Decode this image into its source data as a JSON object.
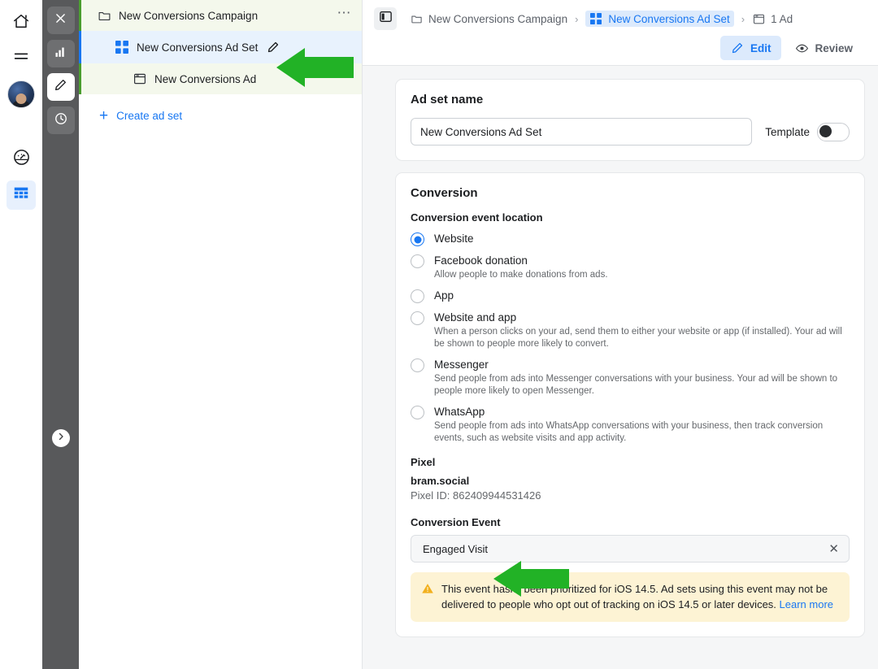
{
  "icon_rail": {
    "items": [
      {
        "name": "home-icon",
        "label": "Home"
      },
      {
        "name": "menu-icon",
        "label": "Menu"
      },
      {
        "name": "avatar",
        "label": "Account"
      },
      {
        "name": "speedometer-icon",
        "label": "Performance"
      },
      {
        "name": "grid-table-icon",
        "label": "Ads Manager"
      }
    ]
  },
  "dark_rail": {
    "items": [
      {
        "name": "close-icon",
        "label": "Close"
      },
      {
        "name": "bar-chart-icon",
        "label": "Reports"
      },
      {
        "name": "pencil-icon",
        "label": "Edit",
        "active": true
      },
      {
        "name": "clock-icon",
        "label": "History"
      }
    ],
    "expand_label": "Expand panel"
  },
  "tree": {
    "rows": [
      {
        "label": "New Conversions Campaign",
        "icon": "folder-icon",
        "kind": "campaign",
        "has_menu": true,
        "has_pencil": false
      },
      {
        "label": "New Conversions Ad Set",
        "icon": "grid-squares-icon",
        "kind": "adset",
        "has_menu": false,
        "has_pencil": true
      },
      {
        "label": "New Conversions Ad",
        "icon": "ad-window-icon",
        "kind": "ad",
        "has_menu": true,
        "has_pencil": false
      }
    ],
    "create_label": "Create ad set",
    "create_plus": "+"
  },
  "topbar": {
    "panel_toggle_name": "panel-toggle-icon",
    "breadcrumb": [
      {
        "label": "New Conversions Campaign",
        "icon": "folder-icon",
        "current": false
      },
      {
        "label": "New Conversions Ad Set",
        "icon": "grid-squares-icon",
        "current": true
      },
      {
        "label": "1 Ad",
        "icon": "ad-window-icon",
        "current": false
      }
    ],
    "separator": "›",
    "actions": [
      {
        "label": "Edit",
        "icon": "pencil-icon",
        "active": true
      },
      {
        "label": "Review",
        "icon": "eye-icon",
        "active": false
      }
    ]
  },
  "ad_set_name": {
    "title": "Ad set name",
    "value": "New Conversions Ad Set",
    "placeholder": "Ad set name",
    "template_label": "Template",
    "template_on": false
  },
  "conversion": {
    "title": "Conversion",
    "event_location_label": "Conversion event location",
    "options": [
      {
        "label": "Website",
        "desc": "",
        "selected": true
      },
      {
        "label": "Facebook donation",
        "desc": "Allow people to make donations from ads.",
        "selected": false
      },
      {
        "label": "App",
        "desc": "",
        "selected": false
      },
      {
        "label": "Website and app",
        "desc": "When a person clicks on your ad, send them to either your website or app (if installed). Your ad will be shown to people more likely to convert.",
        "selected": false
      },
      {
        "label": "Messenger",
        "desc": "Send people from ads into Messenger conversations with your business. Your ad will be shown to people more likely to open Messenger.",
        "selected": false
      },
      {
        "label": "WhatsApp",
        "desc": "Send people from ads into WhatsApp conversations with your business, then track conversion events, such as website visits and app activity.",
        "selected": false
      }
    ],
    "pixel_heading": "Pixel",
    "pixel_name": "bram.social",
    "pixel_id": "Pixel ID: 862409944531426",
    "conversion_event_heading": "Conversion Event",
    "conversion_event_value": "Engaged Visit",
    "conversion_event_clear": "✕",
    "warning": {
      "text": "This event hasn't been prioritized for iOS 14.5. Ad sets using this event may not be delivered to people who opt out of tracking on iOS 14.5 or later devices. ",
      "link": "Learn more"
    }
  },
  "annotations": {
    "arrow_color": "#22b226",
    "arrows": [
      {
        "name": "annotation-arrow-ad-set",
        "points_to": "New Conversions Ad Set row"
      },
      {
        "name": "annotation-arrow-conversion-event",
        "points_to": "Engaged Visit conversion event field"
      }
    ]
  },
  "colors": {
    "accent_blue": "#1877f2",
    "selected_row_bg": "#e8f2fd",
    "green_row_bg": "#f4f8ec",
    "green_accent": "#4a9e2f",
    "warning_bg": "#fdf3d4",
    "page_bg": "#f5f6f7",
    "dark_rail": "#58595b",
    "arrow_green": "#22b226"
  }
}
